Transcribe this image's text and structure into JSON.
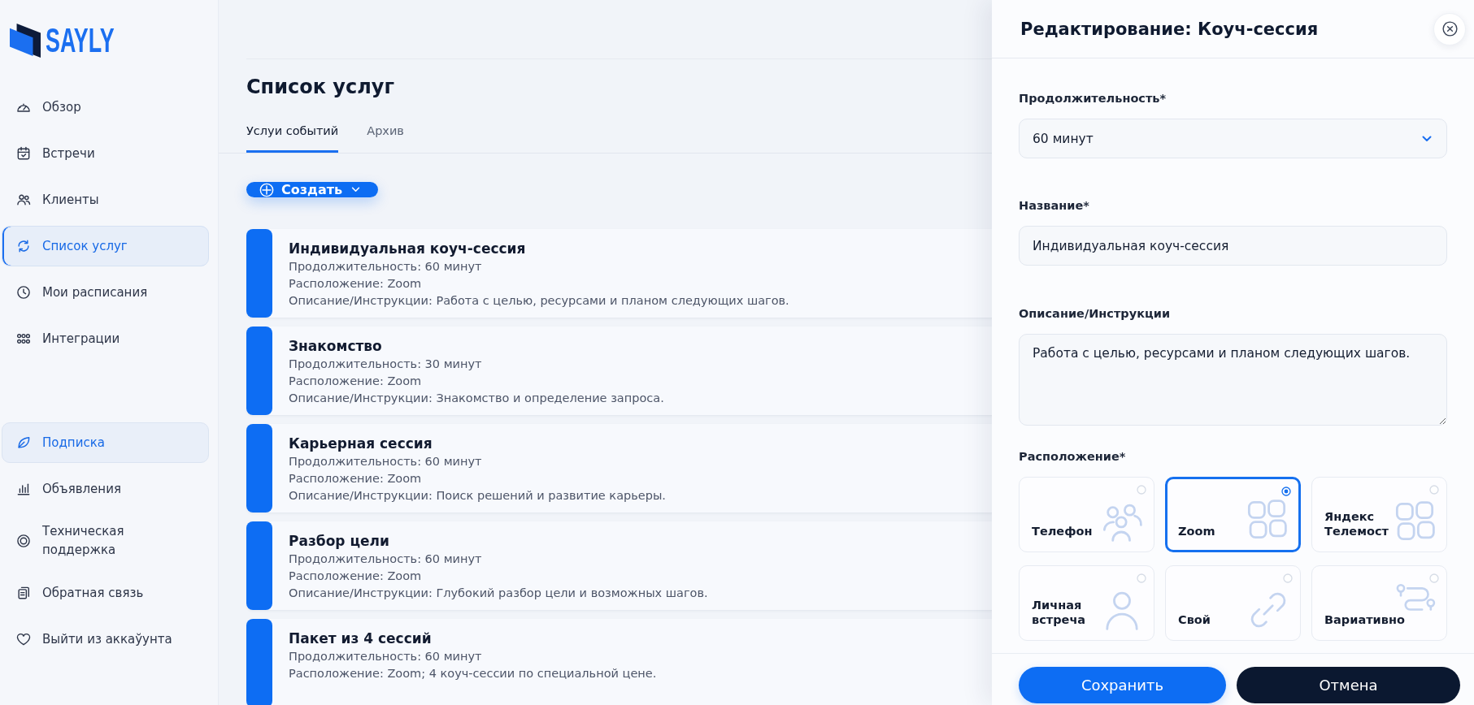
{
  "sidebar": {
    "logo": "SAYLY",
    "items": [
      {
        "label": "Обзор",
        "selected": false,
        "highlighted": false
      },
      {
        "label": "Встречи",
        "selected": false,
        "highlighted": false
      },
      {
        "label": "Клиенты",
        "selected": false,
        "highlighted": false
      },
      {
        "label": "Список услуг",
        "selected": true,
        "highlighted": false
      },
      {
        "label": "Мои расписания",
        "selected": false,
        "highlighted": false
      },
      {
        "label": "Интеграции",
        "selected": false,
        "highlighted": false
      }
    ],
    "secondary_items": [
      {
        "label": "Подписка",
        "selected": false,
        "highlighted": true
      },
      {
        "label": "Объявления",
        "selected": false,
        "highlighted": false
      },
      {
        "label": "Техническая поддержка",
        "selected": false,
        "highlighted": false
      },
      {
        "label": "Обратная связь",
        "selected": false,
        "highlighted": false
      },
      {
        "label": "Выйти из аккаўунта",
        "selected": false,
        "highlighted": false
      }
    ]
  },
  "main": {
    "title": "Список услуг",
    "tabs": [
      {
        "label": "Услуи событий",
        "selected": true
      },
      {
        "label": "Архив",
        "selected": false
      }
    ],
    "create_button": "Создать",
    "services": [
      {
        "name": "Индивидуальная коуч-сессия",
        "lines": [
          "Продолжительность: 60 минут",
          "Расположение: Zoom",
          "Описание/Инструкции: Работа с целью, ресурсами и планом следующих шагов."
        ]
      },
      {
        "name": "Знакомство",
        "lines": [
          "Продолжительность: 30 минут",
          "Расположение: Zoom",
          "Описание/Инструкции: Знакомство и определение запроса."
        ]
      },
      {
        "name": "Карьерная сессия",
        "lines": [
          "Продолжительность: 60 минут",
          "Расположение: Zoom",
          "Описание/Инструкции: Поиск решений и развитие карьеры."
        ]
      },
      {
        "name": "Разбор цели",
        "lines": [
          "Продолжительность: 60 минут",
          "Расположение: Zoom",
          "Описание/Инструкции: Глубокий разбор цели и возможных шагов."
        ]
      },
      {
        "name": "Пакет из 4 сессий",
        "lines": [
          "Продолжительность: 60 минут",
          "Расположение: Zoom; 4 коуч-сессии по специальной цене."
        ]
      }
    ]
  },
  "edit_panel": {
    "title": "Редактирование: Коуч-сессия",
    "duration": {
      "label": "Продолжительность*",
      "value": "60 минут"
    },
    "name": {
      "label": "Название*",
      "value": "Индивидуальная коуч-сессия"
    },
    "description": {
      "label": "Описание/Инструкции",
      "value": "Работа с целью, ресурсами и планом следующих шагов."
    },
    "location": {
      "label": "Расположение*",
      "options": [
        {
          "label": "Телефон",
          "selected": false
        },
        {
          "label": "Zoom",
          "selected": true
        },
        {
          "label": "Яндекс Телемост",
          "selected": false
        },
        {
          "label": "Личная встреча",
          "selected": false
        },
        {
          "label": "Свой",
          "selected": false
        },
        {
          "label": "Вариативно",
          "selected": false
        }
      ]
    },
    "buttons": {
      "save": "Сохранить",
      "cancel": "Отмена"
    }
  }
}
